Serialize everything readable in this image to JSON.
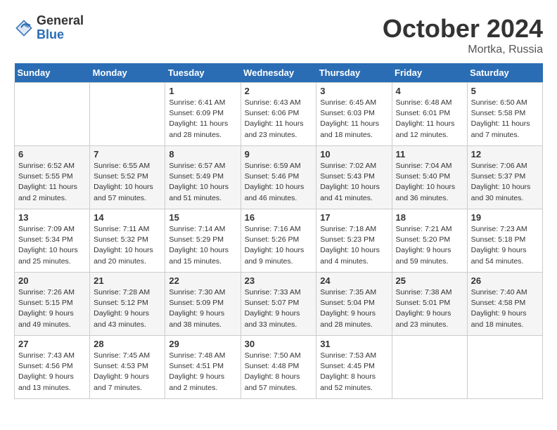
{
  "header": {
    "logo_general": "General",
    "logo_blue": "Blue",
    "month_title": "October 2024",
    "location": "Mortka, Russia"
  },
  "weekdays": [
    "Sunday",
    "Monday",
    "Tuesday",
    "Wednesday",
    "Thursday",
    "Friday",
    "Saturday"
  ],
  "weeks": [
    [
      {
        "day": "",
        "info": ""
      },
      {
        "day": "",
        "info": ""
      },
      {
        "day": "1",
        "info": "Sunrise: 6:41 AM\nSunset: 6:09 PM\nDaylight: 11 hours and 28 minutes."
      },
      {
        "day": "2",
        "info": "Sunrise: 6:43 AM\nSunset: 6:06 PM\nDaylight: 11 hours and 23 minutes."
      },
      {
        "day": "3",
        "info": "Sunrise: 6:45 AM\nSunset: 6:03 PM\nDaylight: 11 hours and 18 minutes."
      },
      {
        "day": "4",
        "info": "Sunrise: 6:48 AM\nSunset: 6:01 PM\nDaylight: 11 hours and 12 minutes."
      },
      {
        "day": "5",
        "info": "Sunrise: 6:50 AM\nSunset: 5:58 PM\nDaylight: 11 hours and 7 minutes."
      }
    ],
    [
      {
        "day": "6",
        "info": "Sunrise: 6:52 AM\nSunset: 5:55 PM\nDaylight: 11 hours and 2 minutes."
      },
      {
        "day": "7",
        "info": "Sunrise: 6:55 AM\nSunset: 5:52 PM\nDaylight: 10 hours and 57 minutes."
      },
      {
        "day": "8",
        "info": "Sunrise: 6:57 AM\nSunset: 5:49 PM\nDaylight: 10 hours and 51 minutes."
      },
      {
        "day": "9",
        "info": "Sunrise: 6:59 AM\nSunset: 5:46 PM\nDaylight: 10 hours and 46 minutes."
      },
      {
        "day": "10",
        "info": "Sunrise: 7:02 AM\nSunset: 5:43 PM\nDaylight: 10 hours and 41 minutes."
      },
      {
        "day": "11",
        "info": "Sunrise: 7:04 AM\nSunset: 5:40 PM\nDaylight: 10 hours and 36 minutes."
      },
      {
        "day": "12",
        "info": "Sunrise: 7:06 AM\nSunset: 5:37 PM\nDaylight: 10 hours and 30 minutes."
      }
    ],
    [
      {
        "day": "13",
        "info": "Sunrise: 7:09 AM\nSunset: 5:34 PM\nDaylight: 10 hours and 25 minutes."
      },
      {
        "day": "14",
        "info": "Sunrise: 7:11 AM\nSunset: 5:32 PM\nDaylight: 10 hours and 20 minutes."
      },
      {
        "day": "15",
        "info": "Sunrise: 7:14 AM\nSunset: 5:29 PM\nDaylight: 10 hours and 15 minutes."
      },
      {
        "day": "16",
        "info": "Sunrise: 7:16 AM\nSunset: 5:26 PM\nDaylight: 10 hours and 9 minutes."
      },
      {
        "day": "17",
        "info": "Sunrise: 7:18 AM\nSunset: 5:23 PM\nDaylight: 10 hours and 4 minutes."
      },
      {
        "day": "18",
        "info": "Sunrise: 7:21 AM\nSunset: 5:20 PM\nDaylight: 9 hours and 59 minutes."
      },
      {
        "day": "19",
        "info": "Sunrise: 7:23 AM\nSunset: 5:18 PM\nDaylight: 9 hours and 54 minutes."
      }
    ],
    [
      {
        "day": "20",
        "info": "Sunrise: 7:26 AM\nSunset: 5:15 PM\nDaylight: 9 hours and 49 minutes."
      },
      {
        "day": "21",
        "info": "Sunrise: 7:28 AM\nSunset: 5:12 PM\nDaylight: 9 hours and 43 minutes."
      },
      {
        "day": "22",
        "info": "Sunrise: 7:30 AM\nSunset: 5:09 PM\nDaylight: 9 hours and 38 minutes."
      },
      {
        "day": "23",
        "info": "Sunrise: 7:33 AM\nSunset: 5:07 PM\nDaylight: 9 hours and 33 minutes."
      },
      {
        "day": "24",
        "info": "Sunrise: 7:35 AM\nSunset: 5:04 PM\nDaylight: 9 hours and 28 minutes."
      },
      {
        "day": "25",
        "info": "Sunrise: 7:38 AM\nSunset: 5:01 PM\nDaylight: 9 hours and 23 minutes."
      },
      {
        "day": "26",
        "info": "Sunrise: 7:40 AM\nSunset: 4:58 PM\nDaylight: 9 hours and 18 minutes."
      }
    ],
    [
      {
        "day": "27",
        "info": "Sunrise: 7:43 AM\nSunset: 4:56 PM\nDaylight: 9 hours and 13 minutes."
      },
      {
        "day": "28",
        "info": "Sunrise: 7:45 AM\nSunset: 4:53 PM\nDaylight: 9 hours and 7 minutes."
      },
      {
        "day": "29",
        "info": "Sunrise: 7:48 AM\nSunset: 4:51 PM\nDaylight: 9 hours and 2 minutes."
      },
      {
        "day": "30",
        "info": "Sunrise: 7:50 AM\nSunset: 4:48 PM\nDaylight: 8 hours and 57 minutes."
      },
      {
        "day": "31",
        "info": "Sunrise: 7:53 AM\nSunset: 4:45 PM\nDaylight: 8 hours and 52 minutes."
      },
      {
        "day": "",
        "info": ""
      },
      {
        "day": "",
        "info": ""
      }
    ]
  ]
}
